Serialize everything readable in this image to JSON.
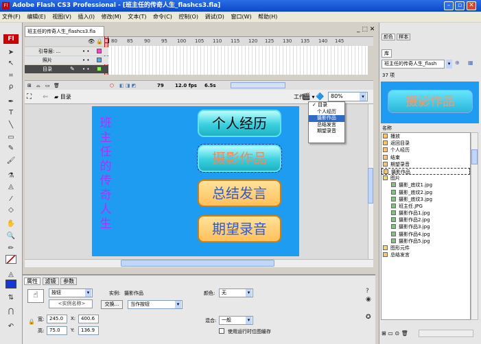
{
  "window": {
    "title": "Adobe Flash CS3 Professional - [班主任的传奇人生_flashcs3.fla]"
  },
  "menu": [
    "文件(F)",
    "编辑(E)",
    "视图(V)",
    "插入(I)",
    "修改(M)",
    "文本(T)",
    "命令(C)",
    "控制(O)",
    "调试(D)",
    "窗口(W)",
    "帮助(H)"
  ],
  "document": {
    "tab": "班主任的传奇人生_flashcs3.fla"
  },
  "timeline": {
    "frames": [
      "80",
      "85",
      "90",
      "95",
      "100",
      "105",
      "110",
      "115",
      "120",
      "125",
      "130",
      "135",
      "140",
      "145"
    ],
    "layers": [
      "引导层: ...",
      "照片",
      "目录"
    ],
    "status": {
      "frame": "79",
      "fps": "12.0 fps",
      "time": "6.5s"
    }
  },
  "editbar": {
    "scene": "目录",
    "workspace": "工作区",
    "zoom": "80%"
  },
  "dropdown": {
    "items": [
      "目录",
      "个人经历",
      "摄影作品",
      "总结发言",
      "期望录音"
    ],
    "selected": "摄影作品",
    "checked": "目录"
  },
  "stage": {
    "vertical_title": [
      "班",
      "主",
      "任",
      "的",
      "传",
      "奇",
      "人",
      "生"
    ],
    "buttons": [
      "个人经历",
      "摄影作品",
      "总结发言",
      "期望录音"
    ]
  },
  "properties": {
    "tabs": [
      "属性",
      "滤镜",
      "参数"
    ],
    "type_select": "按钮",
    "instance_name_placeholder": "<实例名称>",
    "instance_label": "实例:",
    "instance_value": "摄影作品",
    "swap_label": "交换...",
    "track_as": "当作按钮",
    "color_label": "颜色:",
    "color_value": "无",
    "w_label": "宽:",
    "w": "245.0",
    "x_label": "X:",
    "x": "400.6",
    "h_label": "高:",
    "h": "75.0",
    "y_label": "Y:",
    "y": "136.9",
    "blend_label": "混合:",
    "blend": "一般",
    "cache_label": "使用运行时位图缓存"
  },
  "right_panel": {
    "tabs": [
      "颜色",
      "样本"
    ],
    "library_tab": "库",
    "library_doc": "班主任的传奇人生_flash",
    "item_count": "37 项",
    "preview_text": "摄影作品",
    "name_header": "名称",
    "items": [
      "播放",
      "返回目录",
      "个人经历",
      "结束",
      "期望录音",
      "摄影作品",
      "图片",
      "摄影_底纹1.jpg",
      "摄影_底纹2.jpg",
      "摄影_底纹3.jpg",
      "班主任.JPG",
      "摄影作品1.jpg",
      "摄影作品2.jpg",
      "摄影作品3.jpg",
      "摄影作品4.jpg",
      "摄影作品5.jpg",
      "图形元件",
      "总结发言"
    ]
  }
}
